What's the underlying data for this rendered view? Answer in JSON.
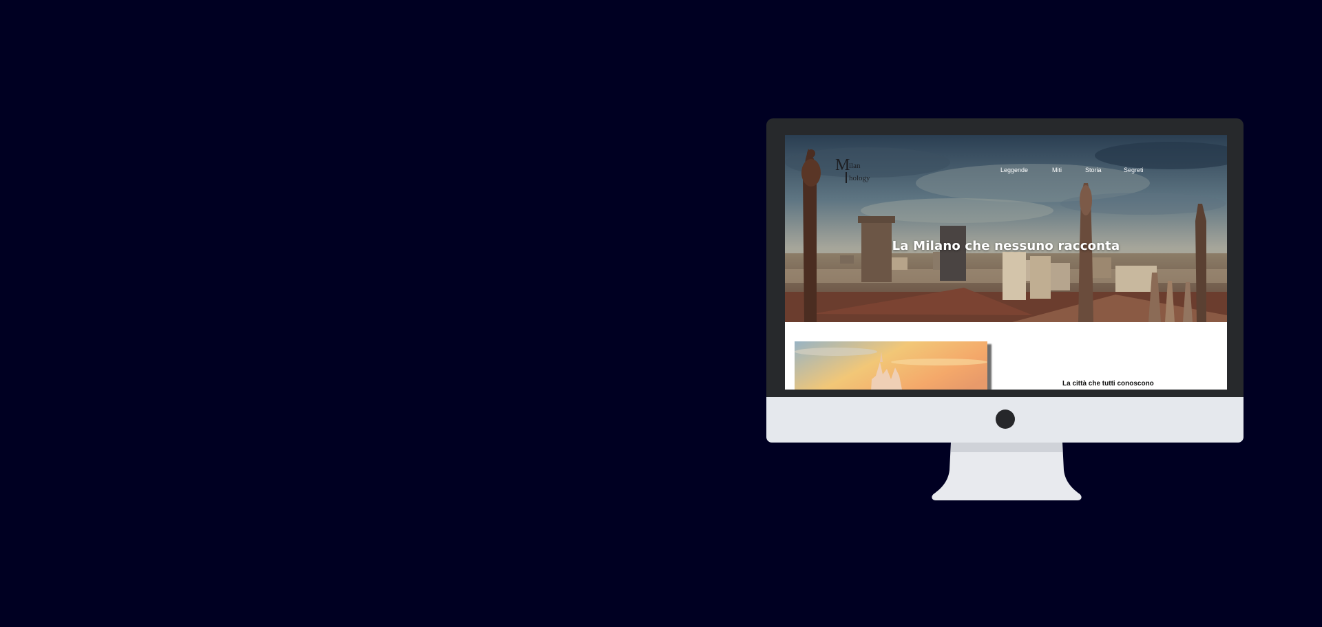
{
  "site": {
    "logo": {
      "big_letter": "M",
      "line1": "ilan",
      "line2": "hology"
    },
    "nav": [
      "Leggende",
      "Miti",
      "Storia",
      "Segreti"
    ],
    "hero_title": "La Milano che nessuno racconta",
    "section_title": "La città che tutti conoscono"
  },
  "colors": {
    "background": "#000022",
    "bezel": "#27292c",
    "chin": "#e5e8ed",
    "stand": "#e8eaee"
  }
}
